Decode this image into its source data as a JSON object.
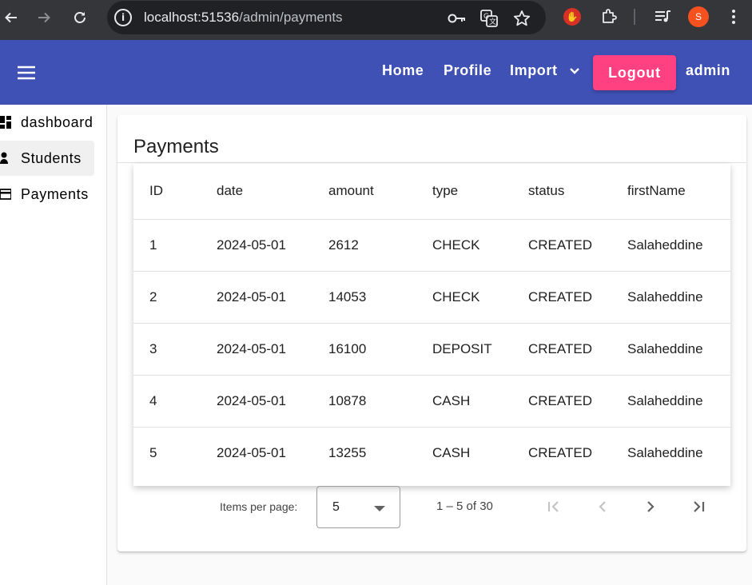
{
  "browser": {
    "url_host": "localhost:51536",
    "url_path": "/admin/payments",
    "profile_initial": "S"
  },
  "toolbar": {
    "home": "Home",
    "profile": "Profile",
    "import": "Import",
    "logout": "Logout",
    "user": "admin"
  },
  "sidebar": {
    "items": [
      {
        "label": "dashboard",
        "icon": "dashboard-icon"
      },
      {
        "label": "Students",
        "icon": "person-icon"
      },
      {
        "label": "Payments",
        "icon": "credit-card-icon"
      }
    ]
  },
  "page": {
    "title": "Payments"
  },
  "table": {
    "headers": [
      "ID",
      "date",
      "amount",
      "type",
      "status",
      "firstName"
    ],
    "rows": [
      [
        "1",
        "2024-05-01",
        "2612",
        "CHECK",
        "CREATED",
        "Salaheddine"
      ],
      [
        "2",
        "2024-05-01",
        "14053",
        "CHECK",
        "CREATED",
        "Salaheddine"
      ],
      [
        "3",
        "2024-05-01",
        "16100",
        "DEPOSIT",
        "CREATED",
        "Salaheddine"
      ],
      [
        "4",
        "2024-05-01",
        "10878",
        "CASH",
        "CREATED",
        "Salaheddine"
      ],
      [
        "5",
        "2024-05-01",
        "13255",
        "CASH",
        "CREATED",
        "Salaheddine"
      ]
    ]
  },
  "paginator": {
    "items_per_page_label": "Items per page:",
    "page_size": "5",
    "range": "1 – 5 of 30"
  },
  "colors": {
    "primary": "#3f51b5",
    "accent": "#ff4081"
  }
}
